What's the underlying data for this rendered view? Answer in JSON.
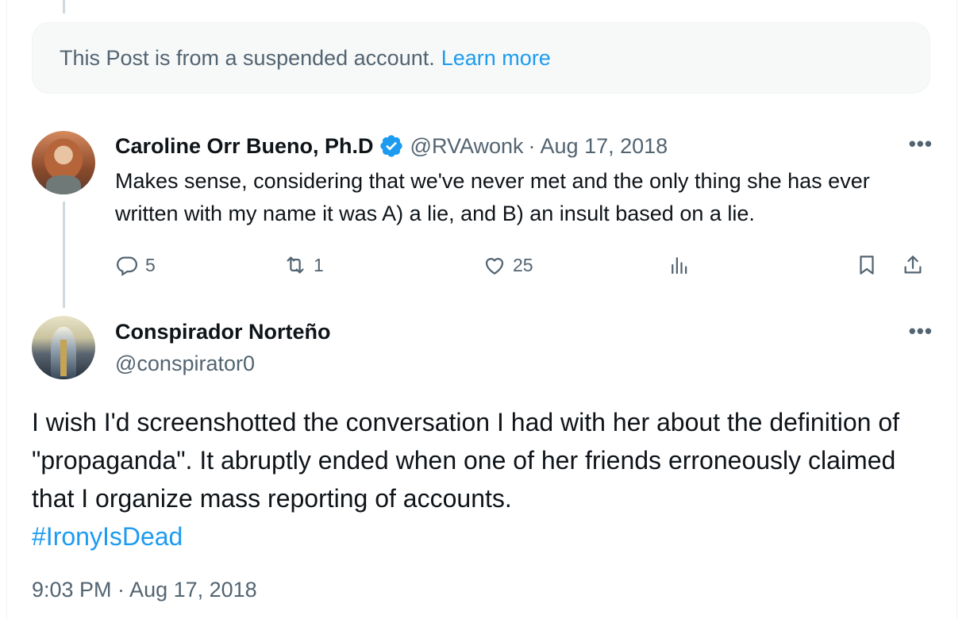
{
  "suspended_notice": {
    "text": "This Post is from a suspended account.",
    "link": "Learn more"
  },
  "reply": {
    "display_name": "Caroline Orr Bueno, Ph.D",
    "handle": "@RVAwonk",
    "separator": "·",
    "date": "Aug 17, 2018",
    "text": "Makes sense, considering that we've never met and the only thing she has ever written with my name it was A) a lie, and B) an insult based on a lie.",
    "more": "•••",
    "stats": {
      "replies": "5",
      "reposts": "1",
      "likes": "25"
    }
  },
  "main_post": {
    "display_name": "Conspirador Norteño",
    "handle": "@conspirator0",
    "more": "•••",
    "text": "I wish I'd screenshotted the conversation I had with her about the definition of \"propaganda\".  It abruptly ended when one of her friends erroneously claimed that I organize mass reporting of accounts.",
    "hashtag": "#IronyIsDead",
    "timestamp": "9:03 PM · Aug 17, 2018"
  },
  "colors": {
    "accent": "#1d9bf0",
    "muted": "#536471",
    "text": "#0f1419"
  }
}
